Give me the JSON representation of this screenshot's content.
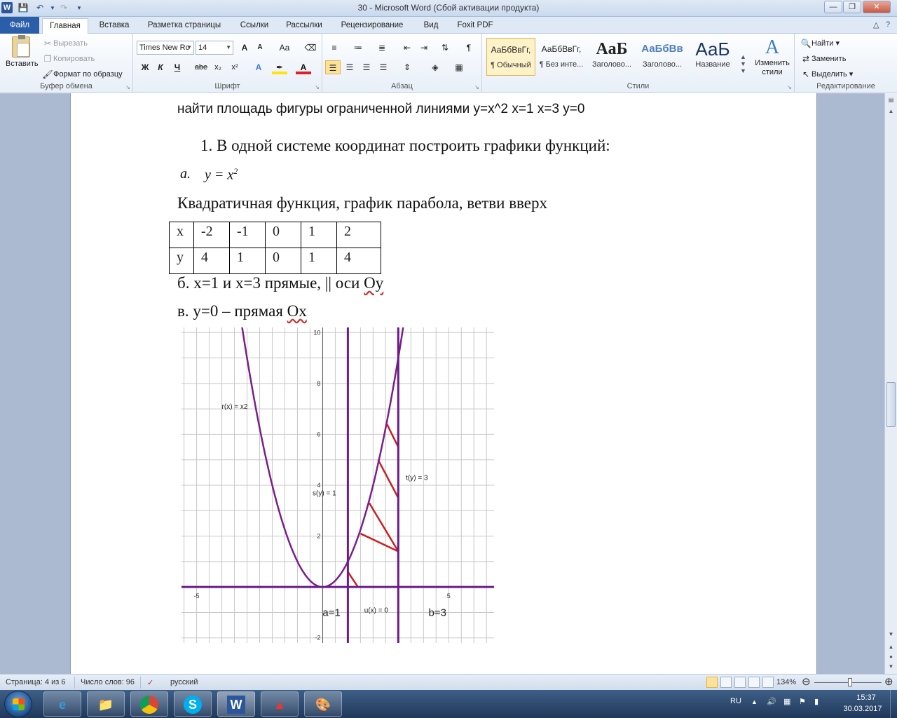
{
  "window": {
    "title": "30  -  Microsoft Word (Сбой активации продукта)",
    "app_icon": "W"
  },
  "tabs": [
    {
      "label": "Файл"
    },
    {
      "label": "Главная"
    },
    {
      "label": "Вставка"
    },
    {
      "label": "Разметка страницы"
    },
    {
      "label": "Ссылки"
    },
    {
      "label": "Рассылки"
    },
    {
      "label": "Рецензирование"
    },
    {
      "label": "Вид"
    },
    {
      "label": "Foxit PDF"
    }
  ],
  "ribbon": {
    "clipboard": {
      "paste": "Вставить",
      "cut": "Вырезать",
      "copy": "Копировать",
      "format_painter": "Формат по образцу",
      "label": "Буфер обмена"
    },
    "font": {
      "family": "Times New Ro",
      "size": "14",
      "grow": "A",
      "shrink": "A",
      "case": "Aa",
      "bold": "Ж",
      "italic": "К",
      "underline": "Ч",
      "strike": "abe",
      "subscript": "x₂",
      "superscript": "x²",
      "label": "Шрифт"
    },
    "paragraph": {
      "label": "Абзац",
      "pilcrow": "¶"
    },
    "styles": {
      "items": [
        {
          "sample": "АаБбВвГг,",
          "name": "¶ Обычный"
        },
        {
          "sample": "АаБбВвГг,",
          "name": "¶ Без инте..."
        },
        {
          "sample": "АаБ",
          "name": "Заголово..."
        },
        {
          "sample": "АаБбВв",
          "name": "Заголово..."
        },
        {
          "sample": "АаБ",
          "name": "Название"
        }
      ],
      "change_styles": "Изменить стили",
      "label": "Стили"
    },
    "editing": {
      "find": "Найти",
      "replace": "Заменить",
      "select": "Выделить",
      "label": "Редактирование"
    }
  },
  "document": {
    "heading": "найти площадь фигуры ограниченной линиями y=x^2 x=1 x=3 y=0",
    "step1": "1.  В одной системе координат построить графики функций:",
    "item_a_label": "a.",
    "item_a_formula": "y = x",
    "item_a_exp": "2",
    "quad_text": "Квадратичная функция, график парабола, ветви вверх",
    "table": {
      "rows": [
        [
          "x",
          "-2",
          "-1",
          "0",
          "1",
          "2"
        ],
        [
          "y",
          "4",
          "1",
          "0",
          "1",
          "4"
        ]
      ]
    },
    "item_b_main": "б. x=1 и x=3  прямые, || оси ",
    "item_b_tail": "Оу",
    "item_v_main": "в. y=0 – прямая ",
    "item_v_tail": "Ох"
  },
  "chart_data": {
    "type": "line",
    "xlim": [
      -5.6,
      6.8
    ],
    "ylim": [
      -2.2,
      10.2
    ],
    "grid": true,
    "x_ticks": [
      {
        "value": -5,
        "label": "-5"
      },
      {
        "value": 5,
        "label": "5"
      }
    ],
    "y_ticks": [
      {
        "value": 10,
        "label": "10"
      },
      {
        "value": 8,
        "label": "8"
      },
      {
        "value": 6,
        "label": "6"
      },
      {
        "value": 4,
        "label": "4"
      },
      {
        "value": 2,
        "label": "2"
      },
      {
        "value": -2,
        "label": "-2"
      }
    ],
    "series": [
      {
        "name": "r(x) = x2",
        "function": "x^2",
        "x_range": [
          -3.2,
          3.2
        ],
        "color": "#7b1e8c"
      },
      {
        "name": "s(y) = 1",
        "vertical_x": 1,
        "color": "#6a1b8a"
      },
      {
        "name": "t(y) = 3",
        "vertical_x": 3,
        "color": "#6a1b8a"
      },
      {
        "name": "u(x) = 0",
        "horizontal_y": 0,
        "color": "#6a1b8a"
      }
    ],
    "series_labels": [
      {
        "text": "r(x) = x2",
        "x": -4.0,
        "y": 7.0
      },
      {
        "text": "s(y) = 1",
        "x": -0.4,
        "y": 3.6
      },
      {
        "text": "t(y) = 3",
        "x": 3.3,
        "y": 4.2
      },
      {
        "text": "u(x) = 0",
        "x": 1.65,
        "y": -1.0
      }
    ],
    "annotations": [
      {
        "text": "a=1",
        "x": 0.0,
        "y": -1.0
      },
      {
        "text": "b=3",
        "x": 4.2,
        "y": -1.0
      }
    ],
    "hatch_color": "#cc1f1f",
    "hatch_lines": [
      [
        [
          1.0,
          0.6
        ],
        [
          1.4,
          0.0
        ]
      ],
      [
        [
          1.5,
          2.1
        ],
        [
          3.0,
          1.4
        ]
      ],
      [
        [
          1.85,
          3.3
        ],
        [
          3.0,
          1.4
        ]
      ],
      [
        [
          2.2,
          5.0
        ],
        [
          3.0,
          3.5
        ]
      ],
      [
        [
          2.55,
          6.4
        ],
        [
          3.0,
          5.5
        ]
      ]
    ]
  },
  "status": {
    "page": "Страница: 4 из 6",
    "words": "Число слов: 96",
    "lang": "русский",
    "zoom": "134%"
  },
  "taskbar": {
    "word_label": "W",
    "skype_label": "S",
    "lang": "RU",
    "time": "15:37",
    "date": "30.03.2017"
  }
}
